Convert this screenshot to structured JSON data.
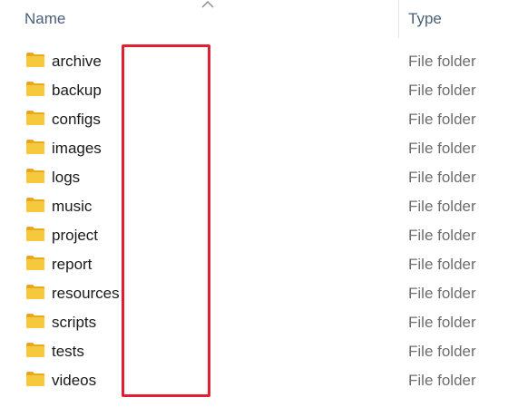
{
  "header": {
    "name_label": "Name",
    "type_label": "Type",
    "sort_icon": "chevron-up-icon"
  },
  "colors": {
    "header_text": "#4c607a",
    "folder_yellow": "#f8c83c",
    "folder_tab": "#e8a820",
    "highlight": "#e02030"
  },
  "files": [
    {
      "name": "archive",
      "type": "File folder",
      "icon": "folder-icon"
    },
    {
      "name": "backup",
      "type": "File folder",
      "icon": "folder-icon"
    },
    {
      "name": "configs",
      "type": "File folder",
      "icon": "folder-icon"
    },
    {
      "name": "images",
      "type": "File folder",
      "icon": "folder-icon"
    },
    {
      "name": "logs",
      "type": "File folder",
      "icon": "folder-icon"
    },
    {
      "name": "music",
      "type": "File folder",
      "icon": "folder-icon"
    },
    {
      "name": "project",
      "type": "File folder",
      "icon": "folder-icon"
    },
    {
      "name": "report",
      "type": "File folder",
      "icon": "folder-icon"
    },
    {
      "name": "resources",
      "type": "File folder",
      "icon": "folder-icon"
    },
    {
      "name": "scripts",
      "type": "File folder",
      "icon": "folder-icon"
    },
    {
      "name": "tests",
      "type": "File folder",
      "icon": "folder-icon"
    },
    {
      "name": "videos",
      "type": "File folder",
      "icon": "folder-icon"
    }
  ]
}
